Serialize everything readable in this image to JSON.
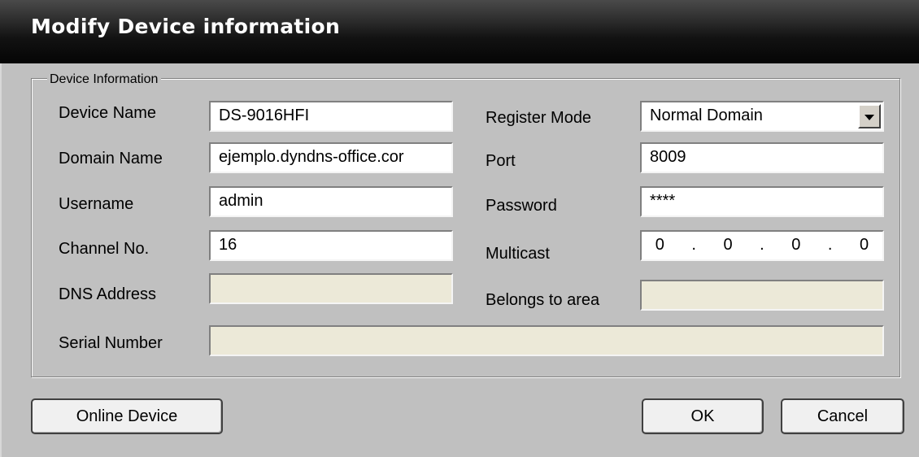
{
  "dialog": {
    "title": "Modify Device information"
  },
  "group": {
    "legend": "Device Information"
  },
  "fields": {
    "device_name": {
      "label": "Device Name",
      "value": "DS-9016HFI"
    },
    "domain_name": {
      "label": "Domain Name",
      "value": "ejemplo.dyndns-office.cor"
    },
    "username": {
      "label": "Username",
      "value": "admin"
    },
    "channel_no": {
      "label": "Channel No.",
      "value": "16"
    },
    "dns_address": {
      "label": "DNS Address",
      "value": ""
    },
    "serial_number": {
      "label": "Serial Number",
      "value": ""
    },
    "register_mode": {
      "label": "Register Mode",
      "value": "Normal Domain"
    },
    "port": {
      "label": "Port",
      "value": "8009"
    },
    "password": {
      "label": "Password",
      "value": "****"
    },
    "multicast": {
      "label": "Multicast",
      "octets": [
        "0",
        "0",
        "0",
        "0"
      ],
      "separator": "."
    },
    "belongs_to_area": {
      "label": "Belongs to area",
      "value": ""
    }
  },
  "buttons": {
    "online_device": "Online Device",
    "ok": "OK",
    "cancel": "Cancel"
  },
  "colors": {
    "title_bar": "#121212",
    "dialog_bg": "#c0c0c0",
    "disabled_field": "#ece9d8"
  },
  "icons": {
    "dropdown": "chevron-down-icon"
  }
}
